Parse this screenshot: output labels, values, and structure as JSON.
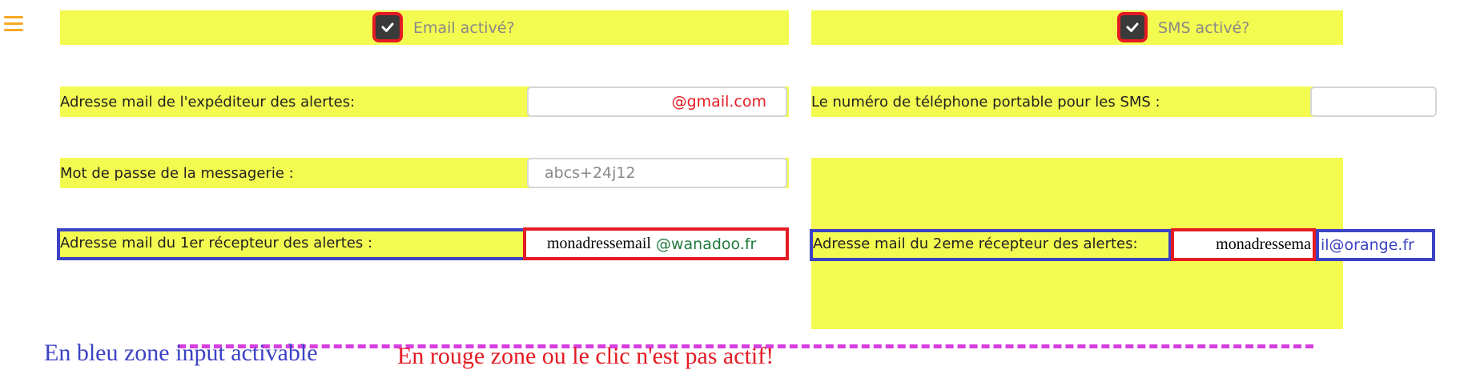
{
  "menu": {
    "icon": "hamburger-menu-icon"
  },
  "email_section": {
    "toggle_label": "Email activé?",
    "toggle_checked": true,
    "sender_label": "Adresse mail de l'expéditeur des alertes:",
    "sender_value": "@gmail.com",
    "password_label": "Mot de passe de la messagerie :",
    "password_value": "abcs+24j12",
    "receiver1_label": "Adresse mail du 1er récepteur des alertes :",
    "receiver1_prefix": "monadressemail",
    "receiver1_domain": "@wanadoo.fr"
  },
  "sms_section": {
    "toggle_label": "SMS activé?",
    "toggle_checked": true,
    "phone_label": "Le numéro de téléphone portable pour les SMS :",
    "phone_value": "",
    "receiver2_label": "Adresse mail du 2eme récepteur des alertes:",
    "receiver2_prefix": "monadressema",
    "receiver2_suffix": "il@orange.fr"
  },
  "legend": {
    "blue_text": "En bleu zone input activable",
    "red_text": "En rouge zone ou le clic n'est pas actif!"
  },
  "colors": {
    "highlight_yellow": "#f3fb50",
    "annotation_red": "#e41b23",
    "annotation_blue": "#3c42c4",
    "dashed_magenta": "#d63fe0",
    "gmail_red": "#e41b23",
    "wanadoo_green": "#1f7a3d",
    "orange_blue": "#3c42c4",
    "menu_orange": "#f7a823"
  }
}
